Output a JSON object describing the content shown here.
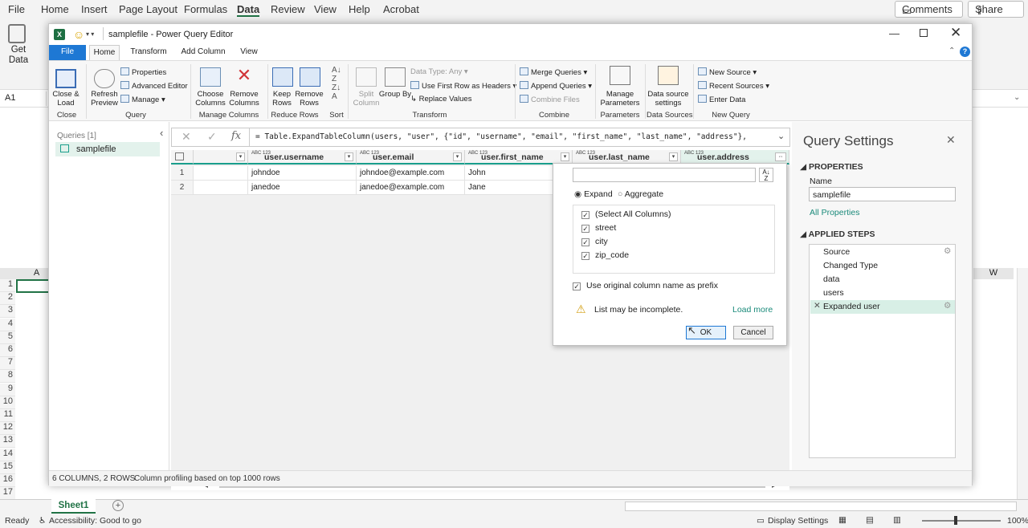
{
  "excel": {
    "menu": [
      "File",
      "Home",
      "Insert",
      "Page Layout",
      "Formulas",
      "Data",
      "Review",
      "View",
      "Help",
      "Acrobat"
    ],
    "active_menu": "Data",
    "comments_label": "Comments",
    "share_label": "Share",
    "get_data_label": "Get Data",
    "name_box": "A1",
    "col_a": "A",
    "col_w": "W",
    "rows": [
      "1",
      "2",
      "3",
      "4",
      "5",
      "6",
      "7",
      "8",
      "9",
      "10",
      "11",
      "12",
      "13",
      "14",
      "15",
      "16",
      "17"
    ],
    "sheet_tab": "Sheet1",
    "status_ready": "Ready",
    "accessibility": "Accessibility: Good to go",
    "display_settings": "Display Settings",
    "zoom": "100%"
  },
  "pq": {
    "title": "samplefile - Power Query Editor",
    "tabs": [
      "File",
      "Home",
      "Transform",
      "Add Column",
      "View"
    ],
    "ribbon": {
      "close_load": "Close & Load",
      "refresh_preview": "Refresh Preview",
      "properties": "Properties",
      "advanced_editor": "Advanced Editor",
      "manage": "Manage",
      "choose_columns": "Choose Columns",
      "remove_columns": "Remove Columns",
      "keep_rows": "Keep Rows",
      "remove_rows": "Remove Rows",
      "split_column": "Split Column",
      "group_by": "Group By",
      "data_type": "Data Type: Any",
      "use_first_row": "Use First Row as Headers",
      "replace_values": "Replace Values",
      "merge_queries": "Merge Queries",
      "append_queries": "Append Queries",
      "combine_files": "Combine Files",
      "manage_parameters": "Manage Parameters",
      "data_source_settings": "Data source settings",
      "new_source": "New Source",
      "recent_sources": "Recent Sources",
      "enter_data": "Enter Data",
      "groups": [
        "Close",
        "Query",
        "Manage Columns",
        "Reduce Rows",
        "Sort",
        "Transform",
        "Combine",
        "Parameters",
        "Data Sources",
        "New Query"
      ]
    },
    "queries_header": "Queries [1]",
    "query_item": "samplefile",
    "formula": "= Table.ExpandTableColumn(users, \"user\", {\"id\", \"username\", \"email\", \"first_name\", \"last_name\", \"address\"},",
    "columns": [
      {
        "type": "",
        "label": ""
      },
      {
        "type": "ABC 123",
        "label": "user.username"
      },
      {
        "type": "ABC 123",
        "label": "user.email"
      },
      {
        "type": "ABC 123",
        "label": "user.first_name"
      },
      {
        "type": "ABC 123",
        "label": "user.last_name"
      },
      {
        "type": "ABC 123",
        "label": "user.address"
      }
    ],
    "rows": [
      {
        "n": "1",
        "username": "johndoe",
        "email": "johndoe@example.com",
        "first_name": "John"
      },
      {
        "n": "2",
        "username": "janedoe",
        "email": "janedoe@example.com",
        "first_name": "Jane"
      }
    ],
    "popup": {
      "expand": "Expand",
      "aggregate": "Aggregate",
      "items": [
        "(Select All Columns)",
        "street",
        "city",
        "zip_code"
      ],
      "prefix": "Use original column name as prefix",
      "warning": "List may be incomplete.",
      "load_more": "Load more",
      "ok": "OK",
      "cancel": "Cancel"
    },
    "settings": {
      "title": "Query Settings",
      "properties": "PROPERTIES",
      "name_label": "Name",
      "name_value": "samplefile",
      "all_properties": "All Properties",
      "applied_steps": "APPLIED STEPS",
      "steps": [
        "Source",
        "Changed Type",
        "data",
        "users",
        "Expanded user"
      ]
    },
    "status_cols": "6 COLUMNS, 2 ROWS",
    "status_profile": "Column profiling based on top 1000 rows"
  }
}
